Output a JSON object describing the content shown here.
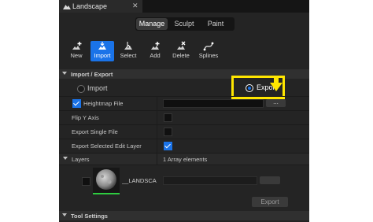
{
  "window": {
    "title": "Landscape",
    "close_glyph": "✕"
  },
  "modes": [
    "Manage",
    "Sculpt",
    "Paint"
  ],
  "active_mode": "Manage",
  "tools": [
    {
      "label": "New",
      "icon": "new-icon"
    },
    {
      "label": "Import",
      "icon": "import-icon",
      "active": true
    },
    {
      "label": "Select",
      "icon": "select-icon"
    },
    {
      "label": "Add",
      "icon": "add-icon"
    },
    {
      "label": "Delete",
      "icon": "delete-icon"
    },
    {
      "label": "Splines",
      "icon": "splines-icon"
    }
  ],
  "import_export": {
    "section_title": "Import / Export",
    "option_import": "Import",
    "option_export": "Export",
    "selected": "Export",
    "heightmap_label": "Heightmap File",
    "heightmap_enabled": true,
    "heightmap_value": "",
    "browse_label": "...",
    "flip_y_label": "Flip Y Axis",
    "flip_y": false,
    "export_single_label": "Export Single File",
    "export_single": false,
    "export_selected_label": "Export Selected Edit Layer",
    "export_selected": true
  },
  "layers": {
    "section_title": "Layers",
    "summary": "1 Array elements",
    "layer_name": "__LANDSCAPE",
    "layer_checked": false,
    "export_button": "Export"
  },
  "tool_settings": {
    "section_title": "Tool Settings"
  },
  "annotation": {
    "color": "#ffe600",
    "arrow_icon": "down-arrow-icon"
  },
  "colors": {
    "accent": "#1a73e8",
    "panel_bg": "#242424",
    "highlight": "#ffe600"
  }
}
